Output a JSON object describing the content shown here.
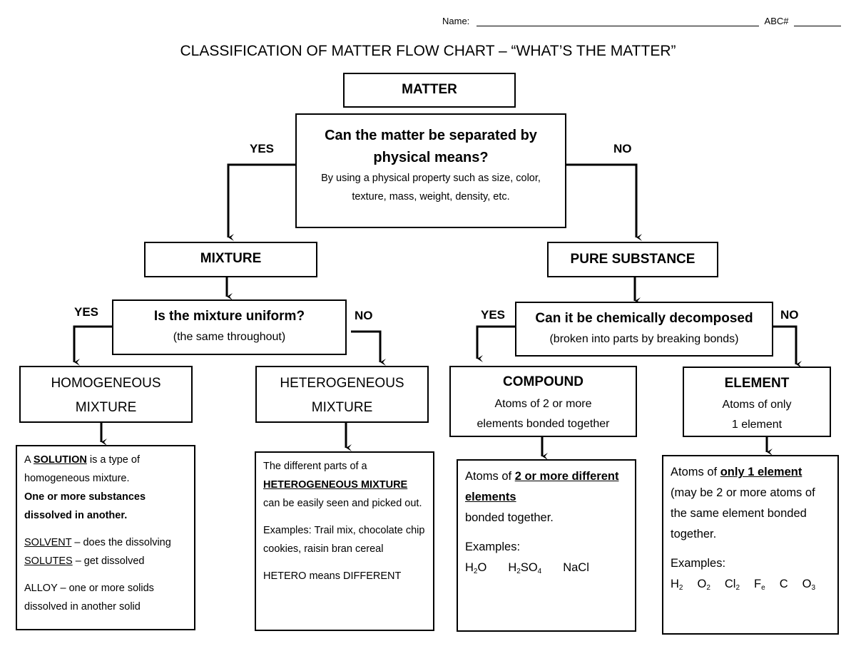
{
  "header": {
    "name_label": "Name:",
    "abc_label": "ABC#"
  },
  "title": "CLASSIFICATION OF MATTER FLOW CHART – “WHAT’S THE MATTER”",
  "nodes": {
    "matter": "MATTER",
    "physical_question": {
      "question_line1": "Can the matter be separated by",
      "question_line2": "physical means?",
      "hint_line1": "By using a physical property such as size, color,",
      "hint_line2": "texture, mass, weight, density, etc."
    },
    "mixture": "MIXTURE",
    "pure_substance": "PURE SUBSTANCE",
    "uniform_question": {
      "question": "Is the mixture uniform?",
      "hint": "(the same throughout)"
    },
    "chemical_question": {
      "question": "Can it be chemically decomposed",
      "hint": "(broken into parts by breaking bonds)"
    },
    "homogeneous": {
      "line1": "HOMOGENEOUS",
      "line2": "MIXTURE"
    },
    "heterogeneous": {
      "line1": "HETEROGENEOUS",
      "line2": "MIXTURE"
    },
    "compound": {
      "title": "COMPOUND",
      "line1": "Atoms of 2 or more",
      "line2": "elements bonded together"
    },
    "element": {
      "title": "ELEMENT",
      "line1": "Atoms of only",
      "line2": "1 element"
    }
  },
  "edge_labels": {
    "physical_yes": "YES",
    "physical_no": "NO",
    "uniform_yes": "YES",
    "uniform_no": "NO",
    "chemical_yes": "YES",
    "chemical_no": "NO"
  },
  "details": {
    "homogeneous": {
      "p1_a": "A ",
      "p1_solution": "SOLUTION",
      "p1_b": " is a type of homogeneous mixture.",
      "p1_bold": "One or more substances dissolved in another.",
      "solvent_term": "SOLVENT",
      "solvent_def": " – does the dissolving",
      "solutes_term": "SOLUTES",
      "solutes_def": " – get dissolved",
      "alloy": "ALLOY – one or more solids dissolved in another solid"
    },
    "heterogeneous": {
      "p1": "The different parts of a",
      "term": "HETEROGENEOUS MIXTURE",
      "p2": "can be easily seen and picked out.",
      "examples": "Examples: Trail mix, chocolate chip cookies, raisin bran cereal",
      "note": "HETERO means DIFFERENT"
    },
    "compound": {
      "p1_a": "Atoms of ",
      "p1_term": "2 or more different elements",
      "p2": "bonded together.",
      "examples_label": "Examples:",
      "examples": [
        {
          "base": "H",
          "sub": "2",
          "rest": "O"
        },
        {
          "base": "H",
          "sub": "2",
          "rest": "SO",
          "sub2": "4"
        },
        {
          "base": "NaCl",
          "sub": "",
          "rest": ""
        }
      ]
    },
    "element": {
      "p1_a": "Atoms of ",
      "p1_term": " only 1 element",
      "p2": "(may be 2 or more atoms of the same element bonded together.",
      "examples_label": "Examples:",
      "examples": [
        {
          "base": "H",
          "sub": "2"
        },
        {
          "base": "O",
          "sub": "2"
        },
        {
          "base": "Cl",
          "sub": "2"
        },
        {
          "base": "F",
          "sub": "e"
        },
        {
          "base": "C",
          "sub": ""
        },
        {
          "base": "O",
          "sub": "3"
        }
      ]
    }
  }
}
